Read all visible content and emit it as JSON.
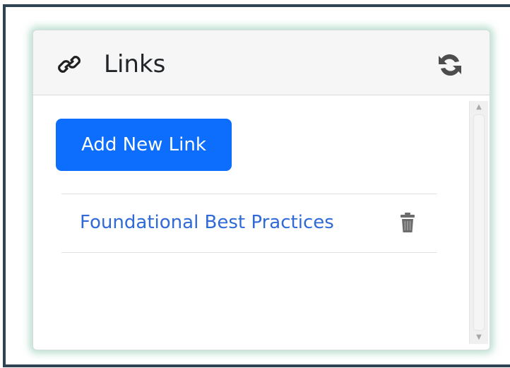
{
  "card": {
    "title": "Links",
    "header_icon": "link-icon",
    "refresh_icon": "refresh-icon"
  },
  "actions": {
    "add_label": "Add New Link"
  },
  "links": [
    {
      "label": "Foundational Best Practices",
      "delete_icon": "trash-icon"
    }
  ],
  "colors": {
    "primary": "#0d6efd",
    "link": "#2f6ad6",
    "frame": "#2f4353",
    "glow": "#8cc8af"
  }
}
